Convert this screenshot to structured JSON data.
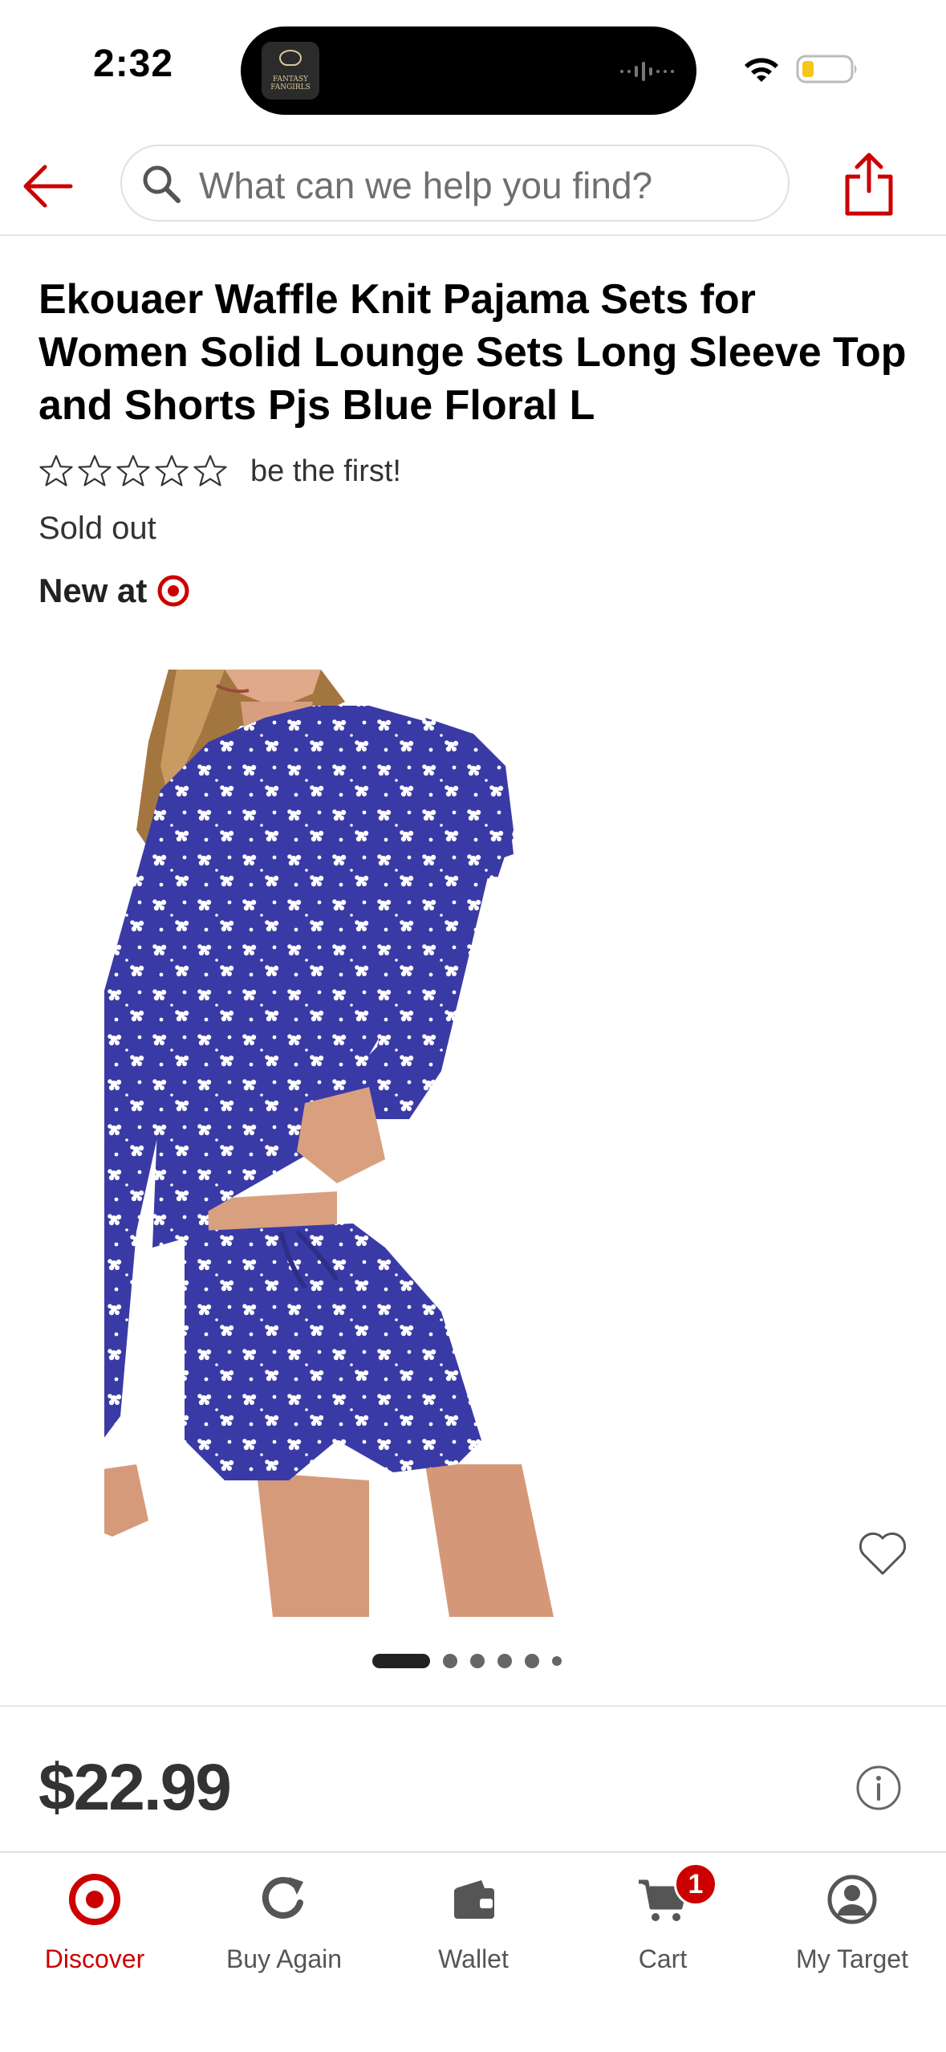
{
  "status_bar": {
    "time": "2:32",
    "island_thumb_text": "FANTASY FANGIRLS"
  },
  "header": {
    "search_placeholder": "What can we help you find?",
    "accent_color": "#cc0000"
  },
  "product": {
    "title": "Ekouaer Waffle Knit Pajama Sets for Women Solid Lounge Sets Long Sleeve Top and Shorts Pjs Blue Floral L",
    "rating_text": "be the first!",
    "rating_stars_filled": 0,
    "rating_stars_total": 5,
    "availability": "Sold out",
    "new_at_label": "New at",
    "price": "$22.99",
    "image_count": 6,
    "image_index": 1
  },
  "bottom_nav": {
    "items": [
      {
        "label": "Discover",
        "icon": "bullseye-icon",
        "active": true
      },
      {
        "label": "Buy Again",
        "icon": "refresh-icon",
        "active": false
      },
      {
        "label": "Wallet",
        "icon": "wallet-icon",
        "active": false
      },
      {
        "label": "Cart",
        "icon": "cart-icon",
        "active": false,
        "badge": "1"
      },
      {
        "label": "My Target",
        "icon": "profile-icon",
        "active": false
      }
    ]
  }
}
